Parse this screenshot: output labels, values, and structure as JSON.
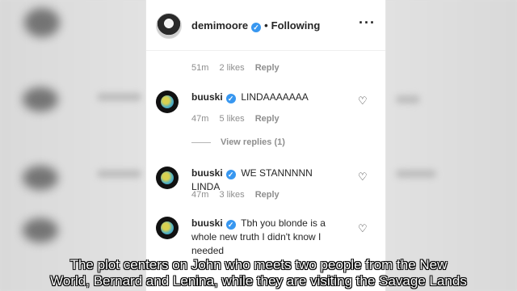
{
  "header": {
    "username": "demimoore",
    "verified": true,
    "separator": "•",
    "follow_status": "Following",
    "more_icon": "more-icon"
  },
  "top_meta": {
    "time": "51m",
    "likes": "2 likes",
    "reply": "Reply"
  },
  "comments": [
    {
      "username": "buuski",
      "text": "LINDAAAAAAA",
      "time": "47m",
      "likes": "5 likes",
      "reply": "Reply",
      "view_replies": "View replies (1)"
    },
    {
      "username": "buuski",
      "text": "WE STANNNNN LINDA",
      "time": "47m",
      "likes": "3 likes",
      "reply": "Reply"
    },
    {
      "username": "buuski",
      "text": "Tbh you blonde is a whole new truth I didn't know I needed"
    }
  ],
  "subtitle": {
    "line1": "The plot centers on John who meets two people from the New",
    "line2": "World, Bernard and Lenina, while they are visiting the Savage Lands"
  },
  "colors": {
    "accent": "#3897f0",
    "text": "#262626",
    "muted": "#8e8e8e"
  }
}
